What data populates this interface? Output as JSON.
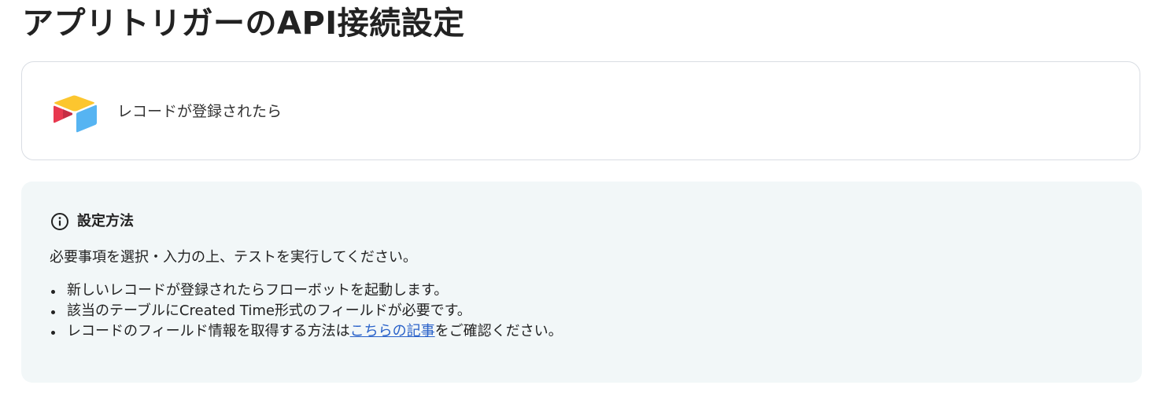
{
  "page": {
    "title": "アプリトリガーのAPI接続設定"
  },
  "trigger": {
    "app_icon": "airtable-logo-icon",
    "label": "レコードが登録されたら"
  },
  "info": {
    "icon": "info-circle-icon",
    "title": "設定方法",
    "lead": "必要事項を選択・入力の上、テストを実行してください。",
    "items": [
      {
        "text": "新しいレコードが登録されたらフローボットを起動します。"
      },
      {
        "text": "該当のテーブルにCreated Time形式のフィールドが必要です。"
      },
      {
        "text_before": "レコードのフィールド情報を取得する方法は",
        "link_text": "こちらの記事",
        "text_after": "をご確認ください。"
      }
    ]
  },
  "colors": {
    "link": "#2a62c9",
    "panel_bg": "#f2f7f8",
    "card_border": "#d9dde3",
    "logo_yellow": "#fcb400",
    "logo_blue": "#18bfff",
    "logo_red": "#f82b60"
  }
}
